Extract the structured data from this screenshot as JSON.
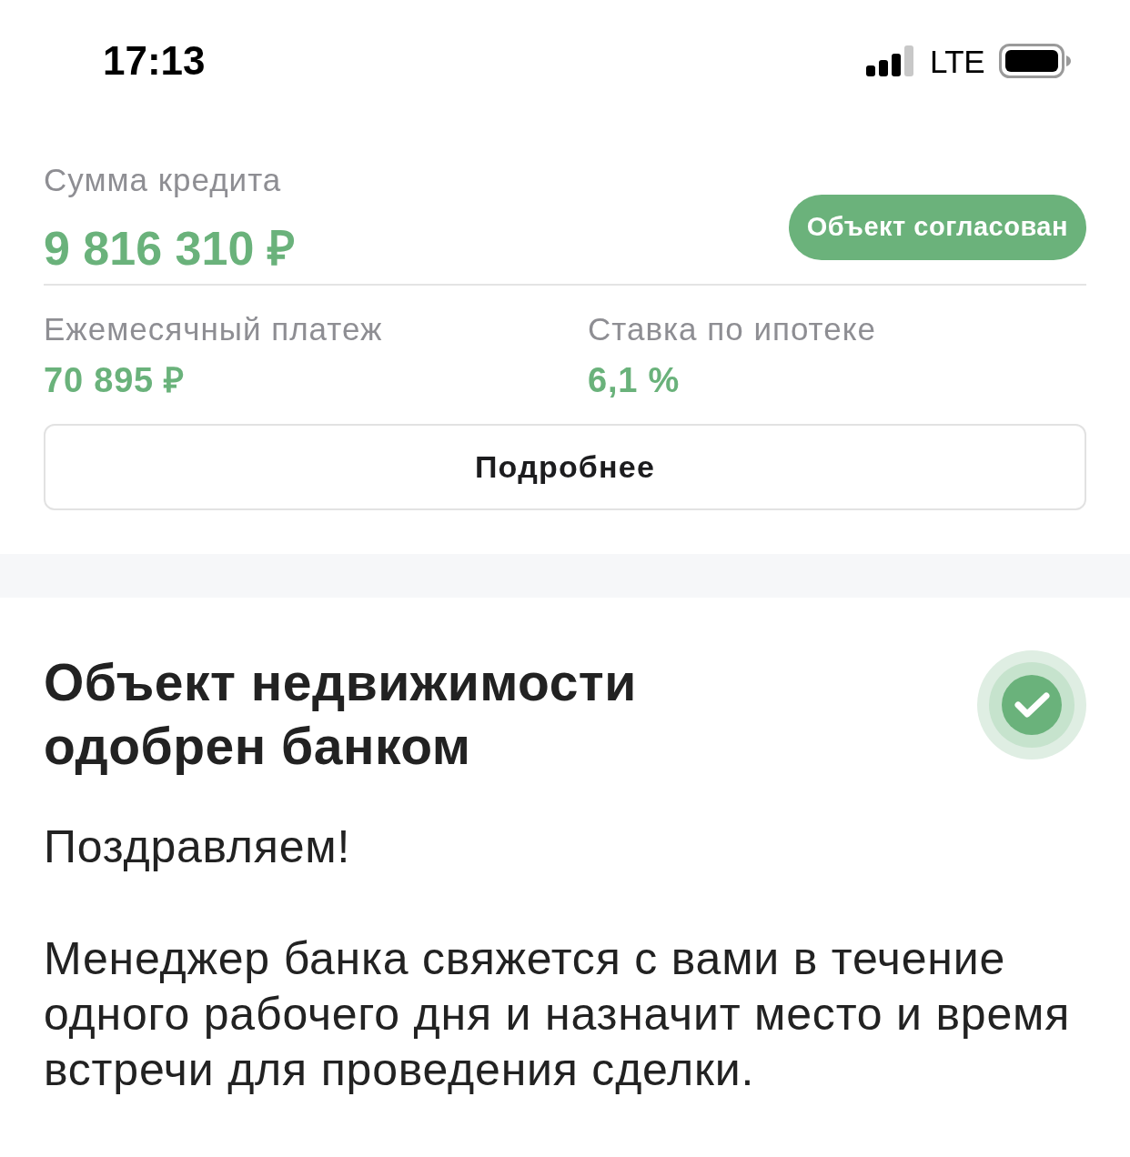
{
  "status_bar": {
    "time": "17:13",
    "network": "LTE"
  },
  "loan": {
    "amount_label": "Сумма кредита",
    "amount": "9 816 310 ₽",
    "status_badge": "Объект согласован",
    "details": [
      {
        "label": "Ежемесячный платеж",
        "value": "70 895 ₽"
      },
      {
        "label": "Ставка по ипотеке",
        "value": "6,1 %"
      }
    ],
    "more_button": "Подробнее"
  },
  "approval": {
    "title": "Объект недвижимости одобрен банком",
    "greeting": "Поздравляем!",
    "message": "Менеджер банка свяжется с вами в течение одного рабочего дня и назначит место и время встречи для проведения сделки."
  }
}
